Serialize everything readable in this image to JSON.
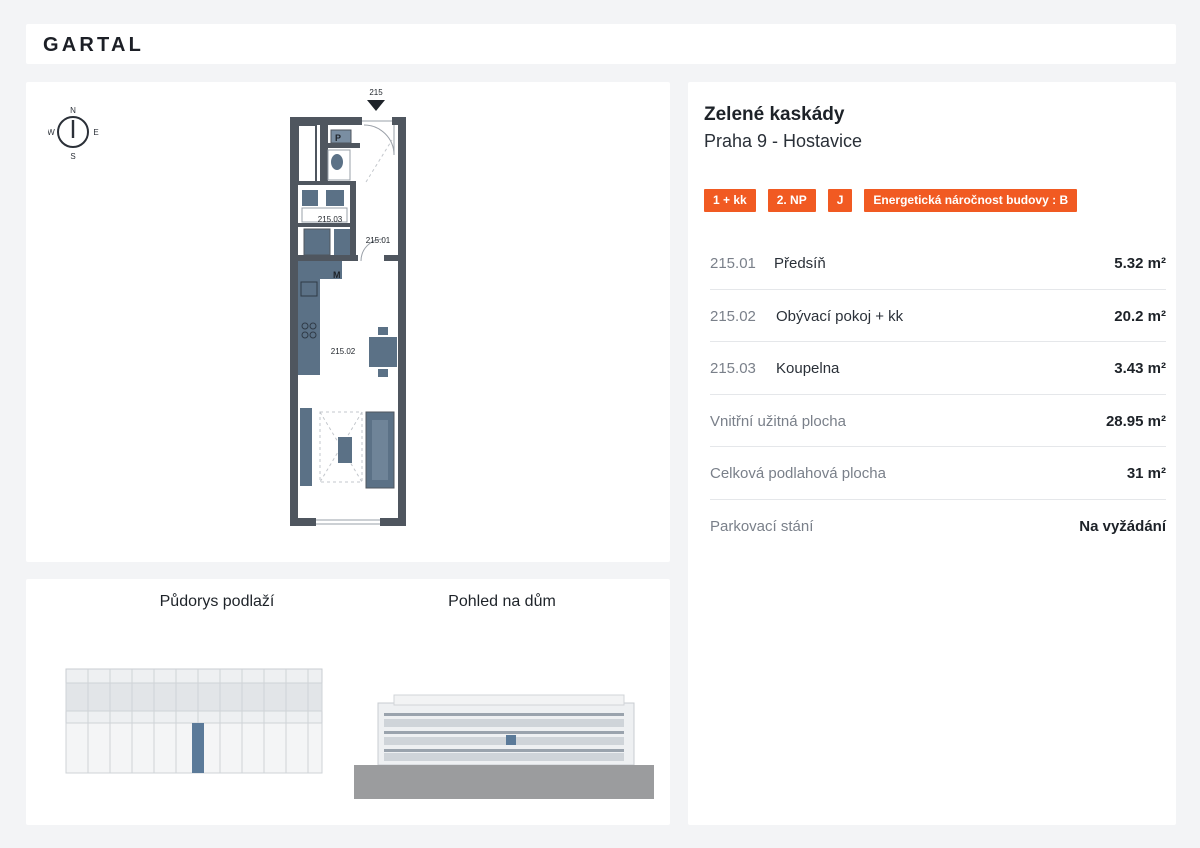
{
  "brand": {
    "logo": "GARTAL"
  },
  "compass": {
    "n": "N",
    "s": "S",
    "e": "E",
    "w": "W"
  },
  "plan": {
    "unit_number": "215",
    "room_labels": [
      "215.03",
      "215.01",
      "215.02"
    ],
    "toilet_mark": "P",
    "meter_mark": "M"
  },
  "views": {
    "floor_plan_title": "Půdorys podlaží",
    "building_view_title": "Pohled na dům"
  },
  "project": {
    "name": "Zelené kaskády",
    "location": "Praha 9 - Hostavice"
  },
  "badges": [
    "1 + kk",
    "2. NP",
    "J",
    "Energetická náročnost budovy : B"
  ],
  "rooms": [
    {
      "code": "215.01",
      "name": "Předsíň",
      "area": "5.32 m²"
    },
    {
      "code": "215.02",
      "name": "Obývací pokoj + kk",
      "area": "20.2 m²"
    },
    {
      "code": "215.03",
      "name": "Koupelna",
      "area": "3.43 m²"
    }
  ],
  "summary": [
    {
      "label": "Vnitřní užitná plocha",
      "value": "28.95 m²"
    },
    {
      "label": "Celková podlahová plocha",
      "value": "31 m²"
    },
    {
      "label": "Parkovací stání",
      "value": "Na vyžádání"
    }
  ],
  "colors": {
    "accent": "#f15a22",
    "wall": "#4f565f",
    "furniture": "#5b7186",
    "floorplan_highlight": "#5b7a99"
  }
}
